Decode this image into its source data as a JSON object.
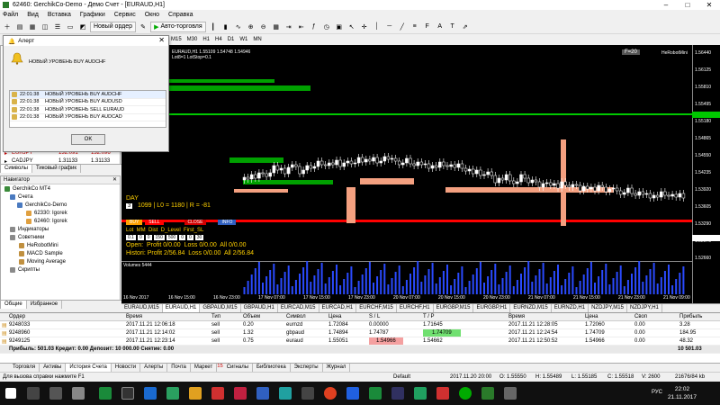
{
  "title": "62460: GerchikCo-Demo - Демо Счет - [EURAUD,H1]",
  "menu": [
    "Файл",
    "Вид",
    "Вставка",
    "Графики",
    "Сервис",
    "Окно",
    "Справка"
  ],
  "toolbar": {
    "new_order": "Новый ордер",
    "auto_trading": "Авто-торговля"
  },
  "timeframes": [
    "M15",
    "M30",
    "H1",
    "H4",
    "D1",
    "W1",
    "MN"
  ],
  "alert": {
    "title": "Алерт",
    "message": "НОВЫЙ УРОВЕНЬ BUY AUDCHF",
    "ok": "OK",
    "rows": [
      {
        "time": "22:01:38",
        "text": "НОВЫЙ УРОВЕНЬ BUY AUDCHF"
      },
      {
        "time": "22:01:38",
        "text": "НОВЫЙ УРОВЕНЬ BUY AUDUSD"
      },
      {
        "time": "22:01:38",
        "text": "НОВЫЙ УРОВЕНЬ SELL EURAUD"
      },
      {
        "time": "22:01:38",
        "text": "НОВЫЙ УРОВЕНЬ BUY AUDCAD"
      }
    ]
  },
  "market": {
    "rows": [
      {
        "sym": "EURJPY",
        "bid": "132.091",
        "ask": "132.096"
      },
      {
        "sym": "CADJPY",
        "bid": "1.31133",
        "ask": "1.31133"
      }
    ],
    "tabs": [
      "Символы",
      "Тиковый график"
    ]
  },
  "nav": {
    "title": "Навигатор",
    "items": [
      "GerchikCo MT4",
      "Счета",
      "GerchikCo-Demo",
      "62330: Igorek",
      "62460: Igorek",
      "Индикаторы",
      "Советники",
      "HeRobotMini",
      "MACD Sample",
      "Moving Average",
      "Скрипты"
    ],
    "tabs": [
      "Общие",
      "Избранное"
    ]
  },
  "chart": {
    "header": "EURAUD,H1 1.55109 1.54748 1.54946",
    "info2": "Lot8=1 LotStop=0.1",
    "corner": "F=20",
    "ea": "HeRobotMini",
    "day_label": "DAY",
    "stats": "1099 | L0 = 1180 | R = -81",
    "day_num": "3",
    "buttons": [
      "BUY",
      "SELL",
      "CLOSE",
      "INFO"
    ],
    "inputs_labels": "Lot  MM  Dist  D_Level  First_SL",
    "inputs": [
      "0.1",
      "0",
      "0",
      "150",
      "500",
      "0",
      "0",
      "30"
    ],
    "open_line": "Open:  Profit 0/0.00  Loss 0/0.00  All 0/0.00",
    "hist_line": "Histori: Profit 2/56.84  Loss 0/0.00  All 2/56.84",
    "volumes": "Volumes 5444",
    "prices": [
      "1.56440",
      "1.56125",
      "1.55810",
      "1.55495",
      "1.55180",
      "1.54865",
      "1.54550",
      "1.54235",
      "1.53920",
      "1.53605",
      "1.53290",
      "1.52975",
      "1.52660"
    ],
    "price_labels": [
      "1.56440",
      "1.56125",
      "1.55810",
      "1.55495",
      "1.55180",
      "1.54865",
      "1.54550",
      "1.54235",
      "1.53920",
      "1.53605",
      "1.53290",
      "1.52975",
      "1.52660"
    ],
    "times": [
      "16 Nov 2017",
      "16 Nov 15:00",
      "16 Nov 23:00",
      "17 Nov 07:00",
      "17 Nov 15:00",
      "17 Nov 23:00",
      "20 Nov 07:00",
      "20 Nov 15:00",
      "20 Nov 23:00",
      "21 Nov 07:00",
      "21 Nov 15:00",
      "21 Nov 23:00",
      "21 Nov 09:00"
    ]
  },
  "chart_tabs": [
    "EURAUD,M15",
    "EURAUD,H1",
    "GBPAUD,M15",
    "GBPAUD,H1",
    "EURCAD,M15",
    "EURCAD,H1",
    "EURCHF,M15",
    "EURCHF,H1",
    "EURGBP,M15",
    "EURGBP,H1",
    "EURNZD,M15",
    "EURNZD,H1",
    "NZDJPY,M15",
    "NZDJPY,H1"
  ],
  "terminal": {
    "headers": [
      "Ордер",
      "Время",
      "Тип",
      "Объем",
      "Символ",
      "Цена",
      "S / L",
      "T / P",
      "Время",
      "Цена",
      "Своп",
      "Прибыль"
    ],
    "rows": [
      [
        "9248033",
        "2017.11.21 12:06:18",
        "sell",
        "0.20",
        "eurnzd",
        "1.72084",
        "0.00000",
        "1.71645",
        "2017.11.21 12:28:05",
        "1.72060",
        "0.00",
        "3.28"
      ],
      [
        "9248960",
        "2017.11.21 12:14:02",
        "sell",
        "1.32",
        "gbpaud",
        "1.74894",
        "1.74787",
        "1.74709",
        "2017.11.21 12:24:54",
        "1.74709",
        "0.00",
        "184.95"
      ],
      [
        "9249125",
        "2017.11.21 12:23:14",
        "sell",
        "0.75",
        "euraud",
        "1.55051",
        "1.54966",
        "1.54662",
        "2017.11.21 12:50:52",
        "1.54966",
        "0.00",
        "48.32"
      ]
    ],
    "summary": "Прибыль: 501.03  Кредит: 0.00  Депозит: 10 000.00  Снятие: 0.00",
    "total": "10 501.03",
    "tabs": [
      "Торговля",
      "Активы",
      "История Счета",
      "Новости",
      "Алерты",
      "Почта",
      "Маркет",
      "Сигналы",
      "Библиотека",
      "Эксперты",
      "Журнал"
    ],
    "market_badge": "15"
  },
  "status": {
    "help": "Для вызова справки нажмите F1",
    "profile": "Default",
    "dt": "2017.11.20 20:00",
    "o": "O: 1.55550",
    "h": "H: 1.55489",
    "l": "L: 1.55185",
    "c": "C: 1.55518",
    "v": "V: 2600",
    "traffic": "21676/84 kb"
  },
  "clock": {
    "time": "22:02",
    "date": "21.11.2017"
  },
  "lang": "РУС",
  "colors": {
    "bull": "#00a000",
    "bear": "#f4a080",
    "green_line": "#00c800",
    "red_line": "#ff0000"
  }
}
